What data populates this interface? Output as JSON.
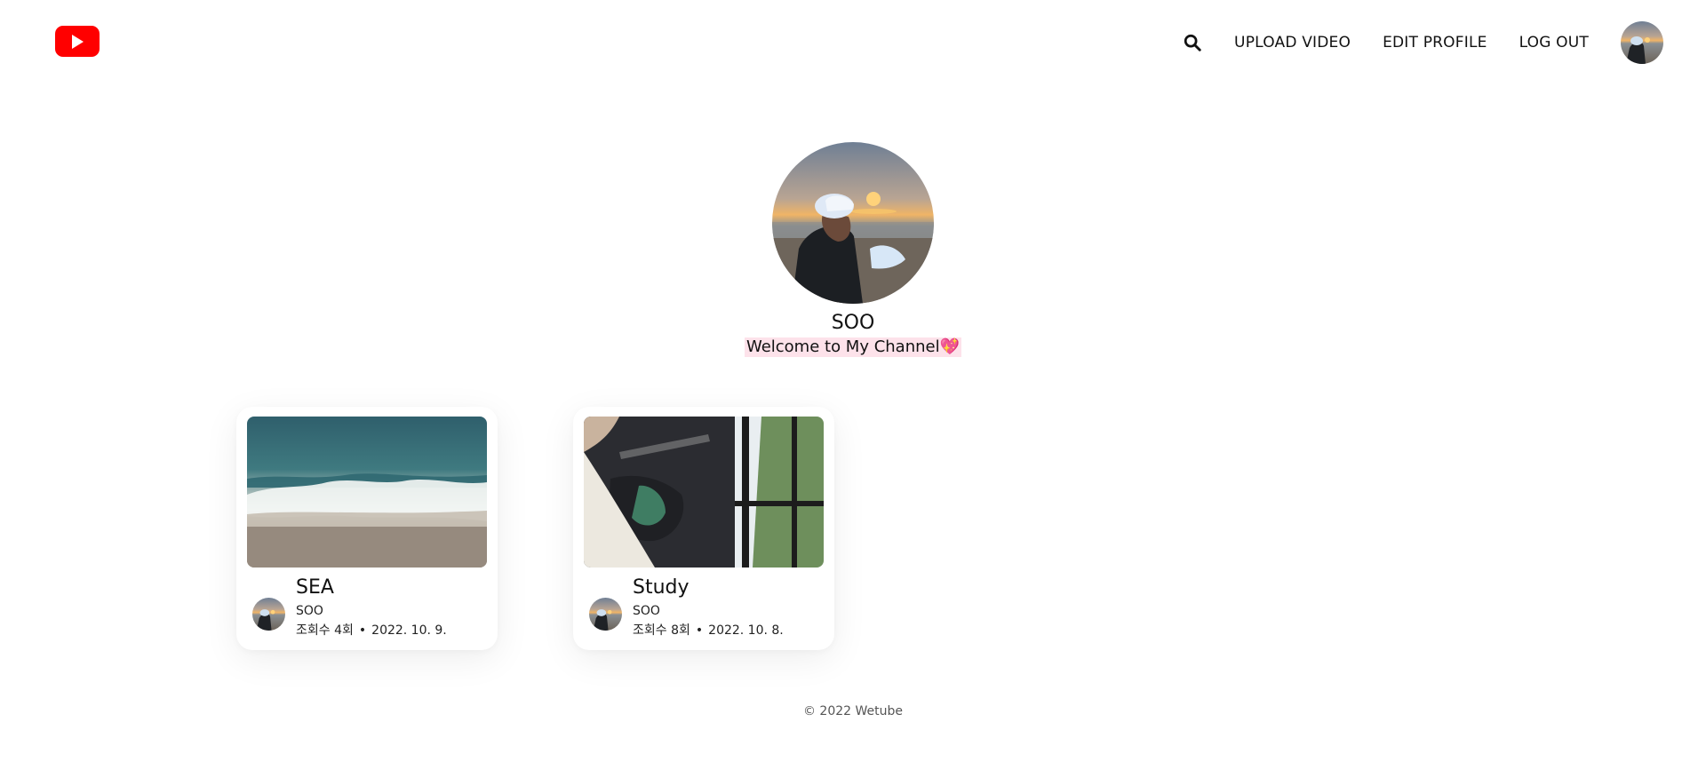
{
  "header": {
    "logo_icon": "youtube-play-icon",
    "brand_color": "#ff0000",
    "nav": {
      "search_icon": "search-icon",
      "upload_label": "UPLOAD VIDEO",
      "edit_label": "EDIT PROFILE",
      "logout_label": "LOG OUT"
    }
  },
  "profile": {
    "name": "SOO",
    "description": "Welcome to My Channel💖",
    "highlight_color": "#fde2ea"
  },
  "videos": [
    {
      "title": "SEA",
      "owner": "SOO",
      "views": "조회수 4회",
      "date": "2022. 10. 9."
    },
    {
      "title": "Study",
      "owner": "SOO",
      "views": "조회수 8회",
      "date": "2022. 10. 8."
    }
  ],
  "footer": {
    "text": "© 2022 Wetube"
  }
}
